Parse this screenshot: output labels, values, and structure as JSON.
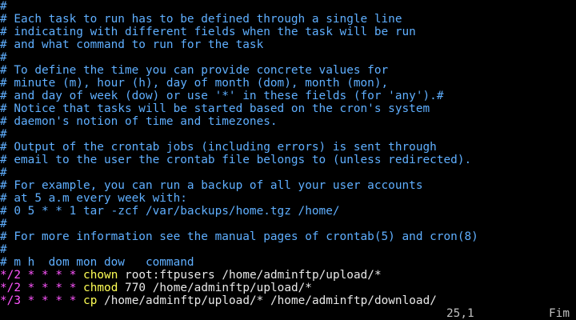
{
  "comment_lines": [
    "#",
    "# Each task to run has to be defined through a single line",
    "# indicating with different fields when the task will be run",
    "# and what command to run for the task",
    "#",
    "# To define the time you can provide concrete values for",
    "# minute (m), hour (h), day of month (dom), month (mon),",
    "# and day of week (dow) or use '*' in these fields (for 'any').#",
    "# Notice that tasks will be started based on the cron's system",
    "# daemon's notion of time and timezones.",
    "#",
    "# Output of the crontab jobs (including errors) is sent through",
    "# email to the user the crontab file belongs to (unless redirected).",
    "#",
    "# For example, you can run a backup of all your user accounts",
    "# at 5 a.m every week with:",
    "# 0 5 * * 1 tar -zcf /var/backups/home.tgz /home/",
    "#",
    "# For more information see the manual pages of crontab(5) and cron(8)",
    "#",
    "# m h  dom mon dow   command"
  ],
  "cron_entries": [
    {
      "minute": "*/2",
      "hour": "*",
      "dom": "*",
      "mon": "*",
      "dow": "*",
      "cmd": "chown",
      "args": "root:ftpusers /home/adminftp/upload/*"
    },
    {
      "minute": "*/2",
      "hour": "*",
      "dom": "*",
      "mon": "*",
      "dow": "*",
      "cmd": "chmod",
      "args": "770 /home/adminftp/upload/*"
    },
    {
      "minute": "*/3",
      "hour": "*",
      "dom": "*",
      "mon": "*",
      "dow": "*",
      "cmd": "cp",
      "args": "/home/adminftp/upload/* /home/adminftp/download/"
    }
  ],
  "status_bar": {
    "cursor_position": "25,1",
    "scroll_position": "Fim"
  },
  "colors": {
    "background": "#000000",
    "comment": "#5fafff",
    "schedule": "#ff55ff",
    "command": "#ffff55",
    "default_text": "#c0c0c0"
  }
}
